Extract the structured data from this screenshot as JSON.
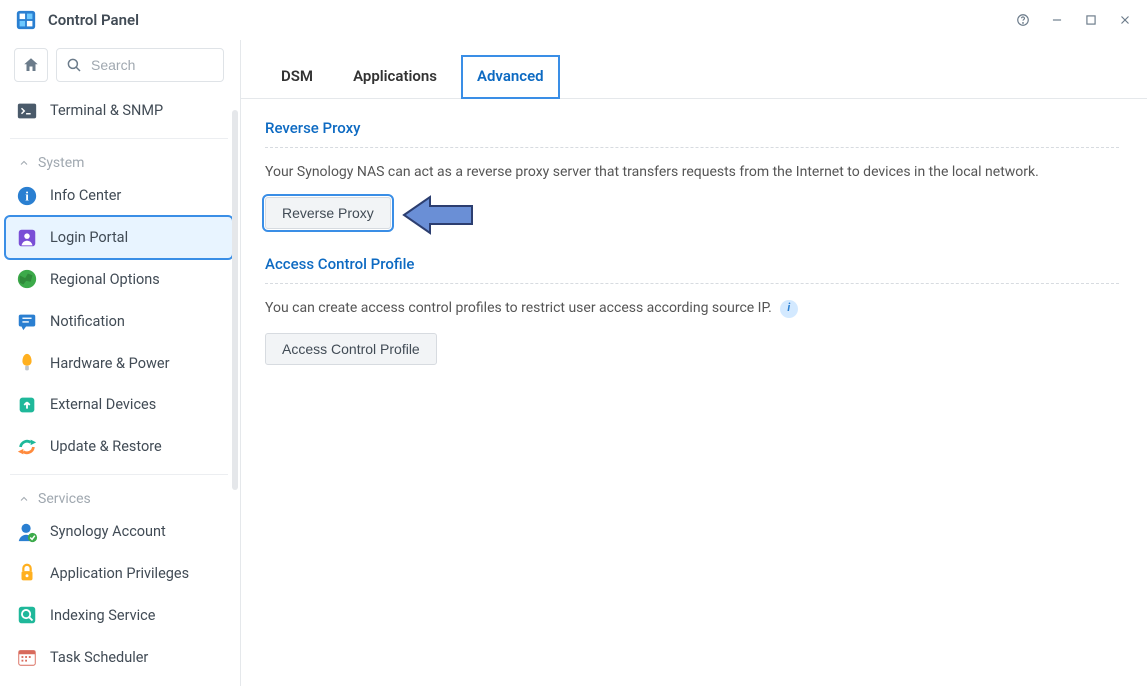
{
  "titlebar": {
    "title": "Control Panel"
  },
  "search": {
    "placeholder": "Search"
  },
  "sidebar": {
    "top_item": {
      "label": "Terminal & SNMP"
    },
    "group_system": {
      "label": "System"
    },
    "system_items": [
      {
        "label": "Info Center"
      },
      {
        "label": "Login Portal"
      },
      {
        "label": "Regional Options"
      },
      {
        "label": "Notification"
      },
      {
        "label": "Hardware & Power"
      },
      {
        "label": "External Devices"
      },
      {
        "label": "Update & Restore"
      }
    ],
    "group_services": {
      "label": "Services"
    },
    "services_items": [
      {
        "label": "Synology Account"
      },
      {
        "label": "Application Privileges"
      },
      {
        "label": "Indexing Service"
      },
      {
        "label": "Task Scheduler"
      }
    ]
  },
  "tabs": {
    "dsm": "DSM",
    "applications": "Applications",
    "advanced": "Advanced"
  },
  "sections": {
    "reverse_proxy": {
      "title": "Reverse Proxy",
      "text": "Your Synology NAS can act as a reverse proxy server that transfers requests from the Internet to devices in the local network.",
      "button": "Reverse Proxy"
    },
    "access_control": {
      "title": "Access Control Profile",
      "text": "You can create access control profiles to restrict user access according source IP.",
      "button": "Access Control Profile"
    }
  },
  "icons": {
    "info": "i"
  }
}
